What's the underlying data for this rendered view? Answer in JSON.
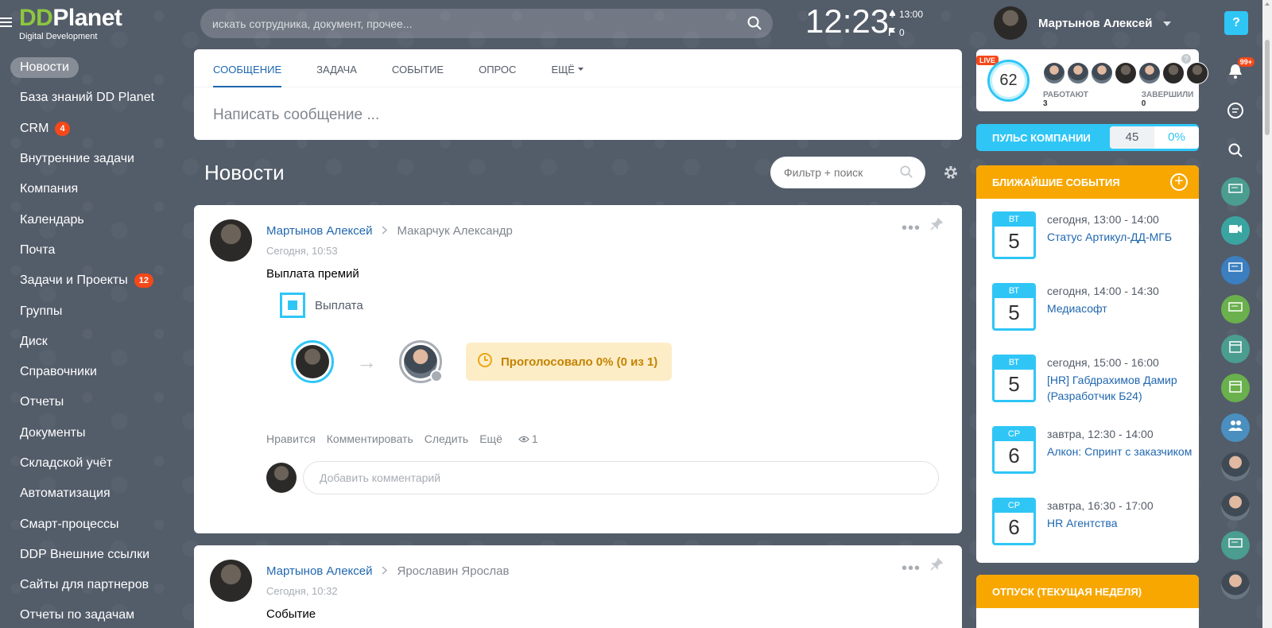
{
  "header": {
    "logo_main_dd": "DD",
    "logo_main_rest": "Planet",
    "logo_sub": "Digital Development",
    "search_placeholder": "искать сотрудника, документ, прочее...",
    "clock": "12:23",
    "alarm_time": "13:00",
    "flag_count": "0",
    "user_name": "Мартынов Алексей",
    "help": "?"
  },
  "left_menu": [
    {
      "label": "Новости",
      "active": true
    },
    {
      "label": "База знаний DD Planet"
    },
    {
      "label": "CRM",
      "badge": "4"
    },
    {
      "label": "Внутренние задачи"
    },
    {
      "label": "Компания"
    },
    {
      "label": "Календарь"
    },
    {
      "label": "Почта"
    },
    {
      "label": "Задачи и Проекты",
      "badge": "12"
    },
    {
      "label": "Группы"
    },
    {
      "label": "Диск"
    },
    {
      "label": "Справочники"
    },
    {
      "label": "Отчеты"
    },
    {
      "label": "Документы"
    },
    {
      "label": "Складской учёт"
    },
    {
      "label": "Автоматизация"
    },
    {
      "label": "Смарт-процессы"
    },
    {
      "label": "DDP Внешние ссылки"
    },
    {
      "label": "Сайты для партнеров"
    },
    {
      "label": "Отчеты по задачам"
    }
  ],
  "composer": {
    "tabs": [
      "СООБЩЕНИЕ",
      "ЗАДАЧА",
      "СОБЫТИЕ",
      "ОПРОС",
      "ЕЩЁ"
    ],
    "placeholder": "Написать сообщение ..."
  },
  "feed": {
    "title": "Новости",
    "filter_placeholder": "Фильтр + поиск"
  },
  "posts": [
    {
      "author": "Мартынов Алексей",
      "recipient": "Макарчук Александр",
      "time": "Сегодня, 10:53",
      "title": "Выплата премий",
      "doc": "Выплата",
      "vote": "Проголосовало 0% (0 из 1)",
      "actions": [
        "Нравится",
        "Комментировать",
        "Следить",
        "Ещё"
      ],
      "views": "1",
      "comment_placeholder": "Добавить комментарий"
    },
    {
      "author": "Мартынов Алексей",
      "recipient": "Ярославин Ярослав",
      "time": "Сегодня, 10:32",
      "title": "Событие"
    }
  ],
  "live": {
    "badge": "LIVE",
    "count": "62",
    "working_label": "РАБОТАЮТ",
    "working": "3",
    "finished_label": "ЗАВЕРШИЛИ",
    "finished": "0",
    "help": "?"
  },
  "pulse": {
    "label": "ПУЛЬС КОМПАНИИ",
    "value": "45",
    "percent": "0%"
  },
  "events": {
    "title": "БЛИЖАЙШИЕ СОБЫТИЯ",
    "items": [
      {
        "day": "ВТ",
        "num": "5",
        "time": "сегодня, 13:00 - 14:00",
        "name": "Статус Артикул-ДД-МГБ"
      },
      {
        "day": "ВТ",
        "num": "5",
        "time": "сегодня, 14:00 - 14:30",
        "name": "Медиасофт"
      },
      {
        "day": "ВТ",
        "num": "5",
        "time": "сегодня, 15:00 - 16:00",
        "name": "[HR] Габдрахимов Дамир (Разработчик Б24)"
      },
      {
        "day": "СР",
        "num": "6",
        "time": "завтра, 12:30 - 14:00",
        "name": "Алкон: Спринт с заказчиком"
      },
      {
        "day": "СР",
        "num": "6",
        "time": "завтра, 16:30 - 17:00",
        "name": "HR Агентства"
      }
    ]
  },
  "vacation": {
    "title": "ОТПУСК (ТЕКУЩАЯ НЕДЕЛЯ)"
  },
  "right_bar": {
    "notif_badge": "99+",
    "colors": [
      "#4a9d8f",
      "#3aa5a0",
      "#3b7fc0",
      "#6ab04c",
      "#4a9d8f",
      "#6ab04c",
      "#4a8fc0"
    ]
  }
}
